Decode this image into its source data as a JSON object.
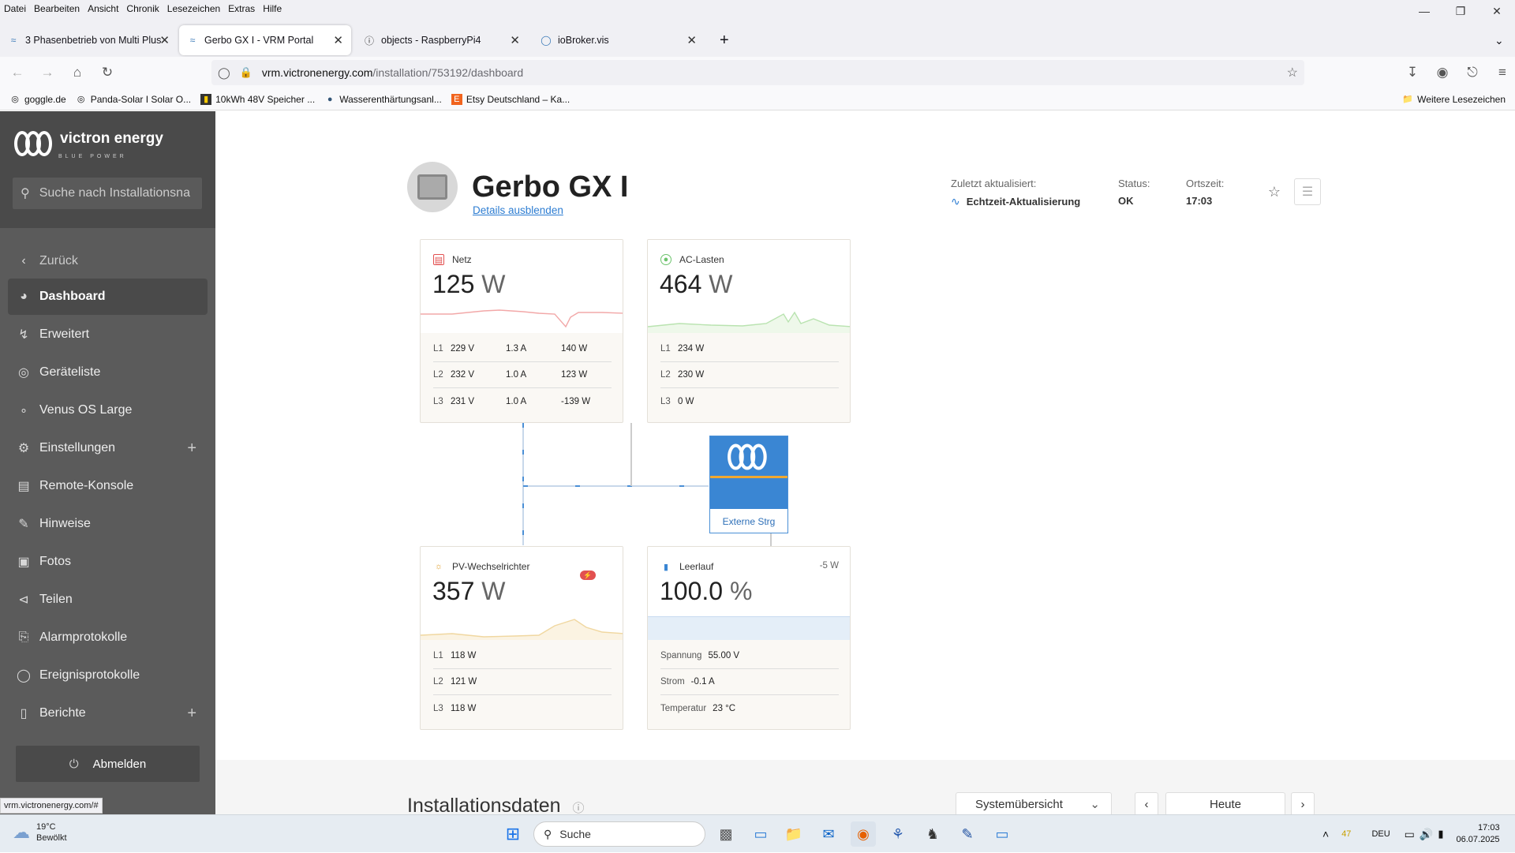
{
  "browser": {
    "menu": [
      "Datei",
      "Bearbeiten",
      "Ansicht",
      "Chronik",
      "Lesezeichen",
      "Extras",
      "Hilfe"
    ],
    "tabs": [
      {
        "label": "3 Phasenbetrieb von Multi Plus",
        "icon": "victron-icon"
      },
      {
        "label": "Gerbo GX I - VRM Portal",
        "icon": "victron-icon"
      },
      {
        "label": "objects - RaspberryPi4",
        "icon": "iobroker-icon"
      },
      {
        "label": "ioBroker.vis",
        "icon": "vis-icon"
      }
    ],
    "url_host": "vrm.victronenergy.com",
    "url_path": "/installation/753192/dashboard",
    "bookmarks": [
      {
        "label": "goggle.de",
        "icon": "globe-icon"
      },
      {
        "label": "Panda-Solar I Solar O...",
        "icon": "globe-icon"
      },
      {
        "label": "10kWh 48V Speicher ...",
        "icon": "battery-icon"
      },
      {
        "label": "Wasserenthärtungsanl...",
        "icon": "water-icon"
      },
      {
        "label": "Etsy Deutschland – Ka...",
        "icon": "etsy-icon"
      }
    ],
    "more_bookmarks": "Weitere Lesezeichen",
    "status_url": "vrm.victronenergy.com/#"
  },
  "sidebar": {
    "brand": "victron energy",
    "brand_sub": "BLUE POWER",
    "search_placeholder": "Suche nach Installationsna",
    "back": "Zurück",
    "items": [
      {
        "label": "Dashboard",
        "icon": "dashboard-icon",
        "active": true
      },
      {
        "label": "Erweitert",
        "icon": "advanced-icon"
      },
      {
        "label": "Geräteliste",
        "icon": "location-icon"
      },
      {
        "label": "Venus OS Large",
        "icon": "nodes-icon"
      },
      {
        "label": "Einstellungen",
        "icon": "gear-icon",
        "expandable": true
      },
      {
        "label": "Remote-Konsole",
        "icon": "console-icon"
      },
      {
        "label": "Hinweise",
        "icon": "edit-icon"
      },
      {
        "label": "Fotos",
        "icon": "photo-icon"
      },
      {
        "label": "Teilen",
        "icon": "share-icon"
      },
      {
        "label": "Alarmprotokolle",
        "icon": "alarm-icon"
      },
      {
        "label": "Ereignisprotokolle",
        "icon": "event-icon"
      },
      {
        "label": "Berichte",
        "icon": "report-icon",
        "expandable": true
      }
    ],
    "logout": "Abmelden"
  },
  "header": {
    "title": "Gerbo GX I",
    "details_link": "Details ausblenden",
    "last_updated_label": "Zuletzt aktualisiert:",
    "last_updated_value": "Echtzeit-Aktualisierung",
    "status_label": "Status:",
    "status_value": "OK",
    "localtime_label": "Ortszeit:",
    "localtime_value": "17:03"
  },
  "cards": {
    "grid": {
      "title": "Netz",
      "value": "125",
      "unit": "W",
      "rows": [
        {
          "label": "L1",
          "v": "229 V",
          "a": "1.3 A",
          "w": "140 W"
        },
        {
          "label": "L2",
          "v": "232 V",
          "a": "1.0 A",
          "w": "123 W"
        },
        {
          "label": "L3",
          "v": "231 V",
          "a": "1.0 A",
          "w": "-139 W"
        }
      ]
    },
    "ac_loads": {
      "title": "AC-Lasten",
      "value": "464",
      "unit": "W",
      "rows": [
        {
          "label": "L1",
          "w": "234 W"
        },
        {
          "label": "L2",
          "w": "230 W"
        },
        {
          "label": "L3",
          "w": "0 W"
        }
      ]
    },
    "pv": {
      "title": "PV-Wechselrichter",
      "value": "357",
      "unit": "W",
      "rows": [
        {
          "label": "L1",
          "w": "118 W"
        },
        {
          "label": "L2",
          "w": "121 W"
        },
        {
          "label": "L3",
          "w": "118 W"
        }
      ]
    },
    "battery": {
      "title": "Leerlauf",
      "value": "100.0",
      "unit": "%",
      "power": "-5 W",
      "soc_fraction": 1.0,
      "rows": [
        {
          "label": "Spannung",
          "v": "55.00 V"
        },
        {
          "label": "Strom",
          "v": "-0.1 A"
        },
        {
          "label": "Temperatur",
          "v": "23 °C"
        }
      ]
    }
  },
  "inverter": {
    "label": "Externe Strg"
  },
  "bottom": {
    "title": "Installationsdaten",
    "view_select": "Systemübersicht",
    "period": "Heute"
  },
  "taskbar": {
    "weather_temp": "19°C",
    "weather_desc": "Bewölkt",
    "search_placeholder": "Suche",
    "badge": "47",
    "lang": "DEU",
    "time": "17:03",
    "date": "06.07.2025"
  },
  "colors": {
    "sidebar": "#5b5b5b",
    "accent": "#2d7dd2",
    "victron_blue": "#3a86d3",
    "inverter_stripe": "#f0a830"
  }
}
